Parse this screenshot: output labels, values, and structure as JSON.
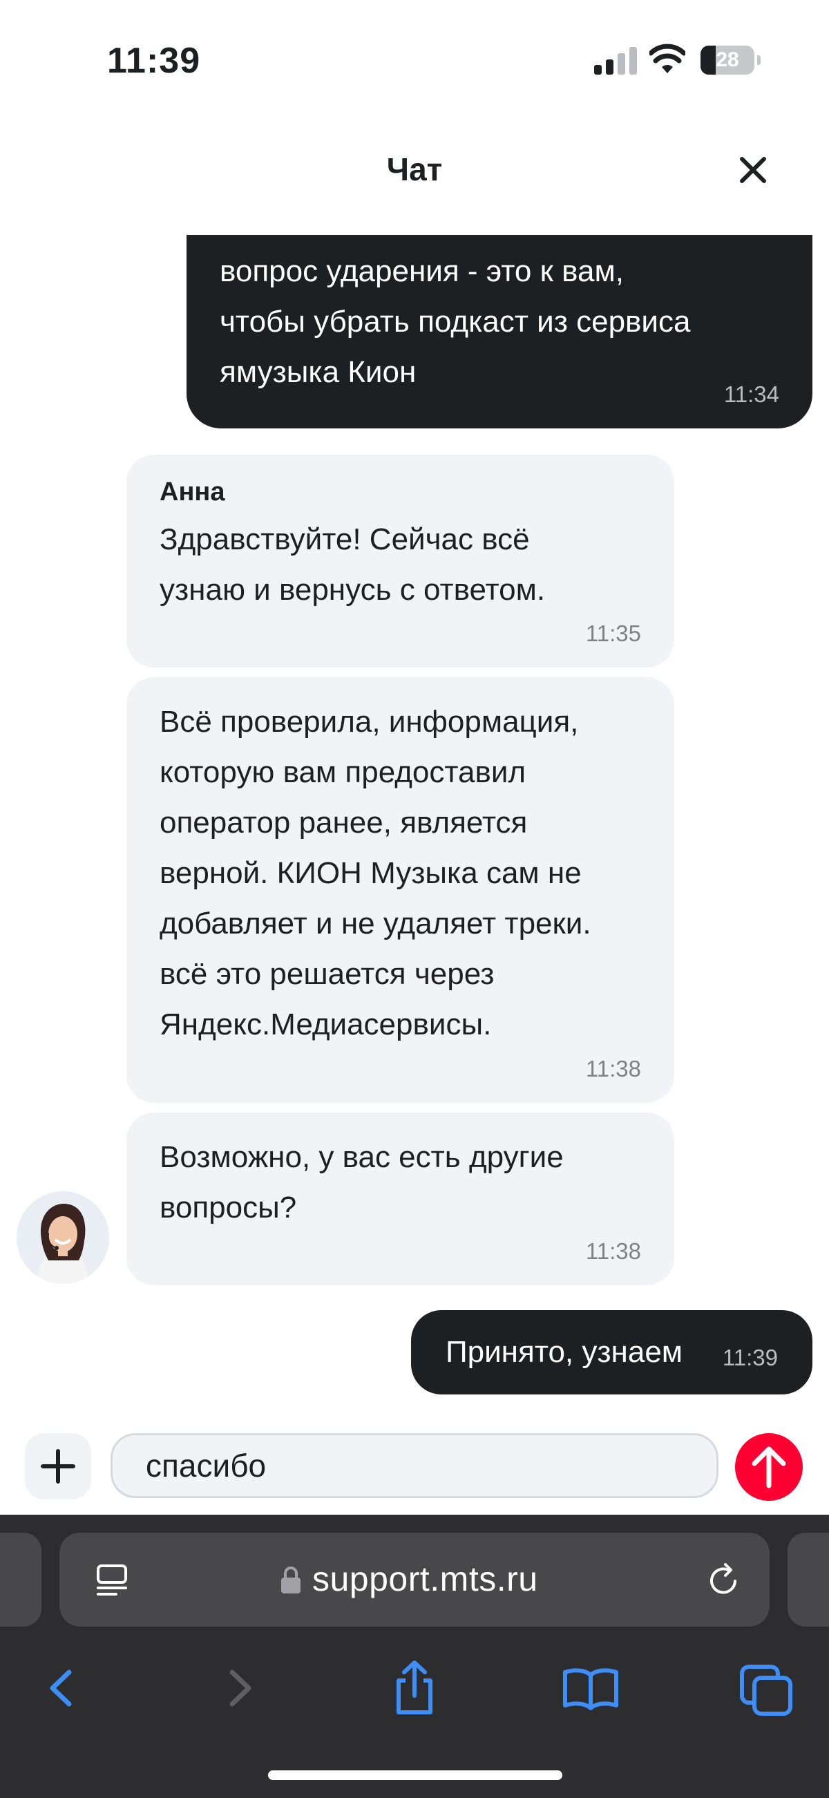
{
  "status_bar": {
    "time": "11:39",
    "battery_level": "28"
  },
  "header": {
    "title": "Чат"
  },
  "messages": [
    {
      "direction": "outgoing",
      "text": "вопрос ударения - это к вам,\nчтобы убрать подкаст из сервиса\nямузыка Кион",
      "time": "11:34"
    },
    {
      "direction": "incoming",
      "sender": "Анна",
      "text": "Здравствуйте! Сейчас всё\nузнаю и вернусь с ответом.",
      "time": "11:35"
    },
    {
      "direction": "incoming",
      "text": "Всё проверила, информация,\nкоторую вам предоставил\nоператор ранее, является\nверной. КИОН Музыка сам не\nдобавляет и не удаляет треки.\nвсё это решается через\nЯндекс.Медиасервисы.",
      "time": "11:38"
    },
    {
      "direction": "incoming",
      "text": "Возможно, у вас есть другие\nвопросы?",
      "time": "11:38"
    },
    {
      "direction": "outgoing",
      "text": "Принято, узнаем",
      "time": "11:39"
    }
  ],
  "composer": {
    "value": "спасибо"
  },
  "browser": {
    "url": "support.mts.ru"
  },
  "colors": {
    "accent": "#ff0032",
    "outgoing_bubble": "#1d2023",
    "incoming_bubble": "#f2f3f7",
    "browser_link": "#3d8ef7"
  }
}
